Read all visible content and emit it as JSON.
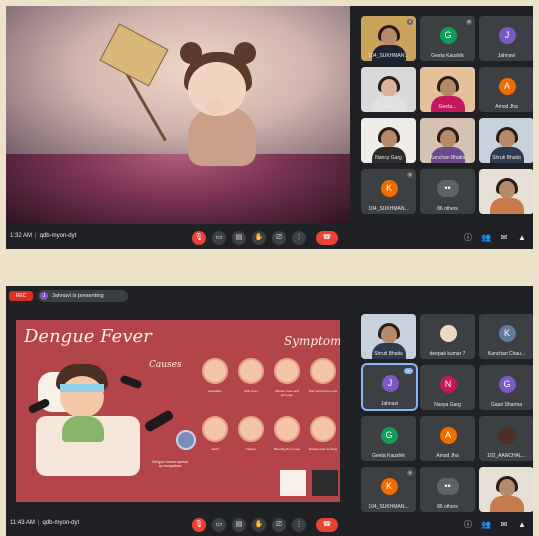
{
  "colors": {
    "meet_background": "#202124",
    "tile_background": "#3c4043",
    "end_call": "#ea4335",
    "slide_background": "#b3454a",
    "active_outline": "#8ab4f8"
  },
  "top": {
    "tiles": [
      {
        "name": "104_SUKHMAN..."
      },
      {
        "name": "Geeta Kaushik",
        "initial": "G",
        "avatar_color": "#0f9d58"
      },
      {
        "name": "Jahnavi",
        "initial": "J",
        "avatar_color": "#7b58c2"
      },
      {
        "name": "Geeta..."
      },
      {
        "name": "Geeta..."
      },
      {
        "name": "Amod Jha",
        "initial": "A",
        "avatar_color": "#ef6c00"
      },
      {
        "name": "Nancy Garg"
      },
      {
        "name": "Kanchan Bhatia"
      },
      {
        "name": "Shruti Bhatia"
      },
      {
        "name": "104_SUKHMAN...",
        "initial": "K",
        "avatar_color": "#ef6c00"
      },
      {
        "name": "86 others"
      },
      {
        "name": ""
      }
    ],
    "bar": {
      "time": "1:32 AM",
      "code": "qdb-myon-dyt"
    }
  },
  "bottom": {
    "recording_label": "REC",
    "presenter_initial": "J",
    "presenting_label": "Jahnavi is presenting",
    "slide": {
      "title": "Dengue Fever",
      "symptoms_heading": "Symptoms",
      "causes_heading": "Causes",
      "cause_caption": "Dengue viruses spread by mosquitoes",
      "symptom_captions": [
        "Headache",
        "High fever",
        "Muscle, bone and joint pain",
        "Pain behind the eyes",
        "Rash",
        "Fatigue",
        "Bleeding from nose",
        "Nausea and vomiting"
      ]
    },
    "tiles": [
      {
        "name": "Shruti Bhatia"
      },
      {
        "name": "deepak kumar 7"
      },
      {
        "name": "Kanchan Chau...",
        "initial": "K",
        "avatar_color": "#5f7d9b"
      },
      {
        "name": "Jahnavi",
        "initial": "J",
        "avatar_color": "#7b58c2",
        "active": true
      },
      {
        "name": "Navya Garg",
        "initial": "N",
        "avatar_color": "#c2185b"
      },
      {
        "name": "Gauri Sharma",
        "initial": "G",
        "avatar_color": "#7b58c2"
      },
      {
        "name": "Geeta Kaushik",
        "initial": "G",
        "avatar_color": "#0f9d58"
      },
      {
        "name": "Amod Jha",
        "initial": "A",
        "avatar_color": "#ef6c00"
      },
      {
        "name": "102_AANCHAL..."
      },
      {
        "name": "104_SUKHMAN...",
        "initial": "K",
        "avatar_color": "#ef6c00"
      },
      {
        "name": "86 others"
      },
      {
        "name": ""
      }
    ],
    "bar": {
      "time": "11:43 AM",
      "code": "qdb-myon-dyt"
    }
  },
  "icons": [
    "mic-off-icon",
    "camera-icon",
    "captions-icon",
    "raise-hand-icon",
    "present-icon",
    "more-options-icon",
    "end-call-icon",
    "info-icon",
    "people-icon",
    "chat-icon",
    "activities-icon"
  ]
}
